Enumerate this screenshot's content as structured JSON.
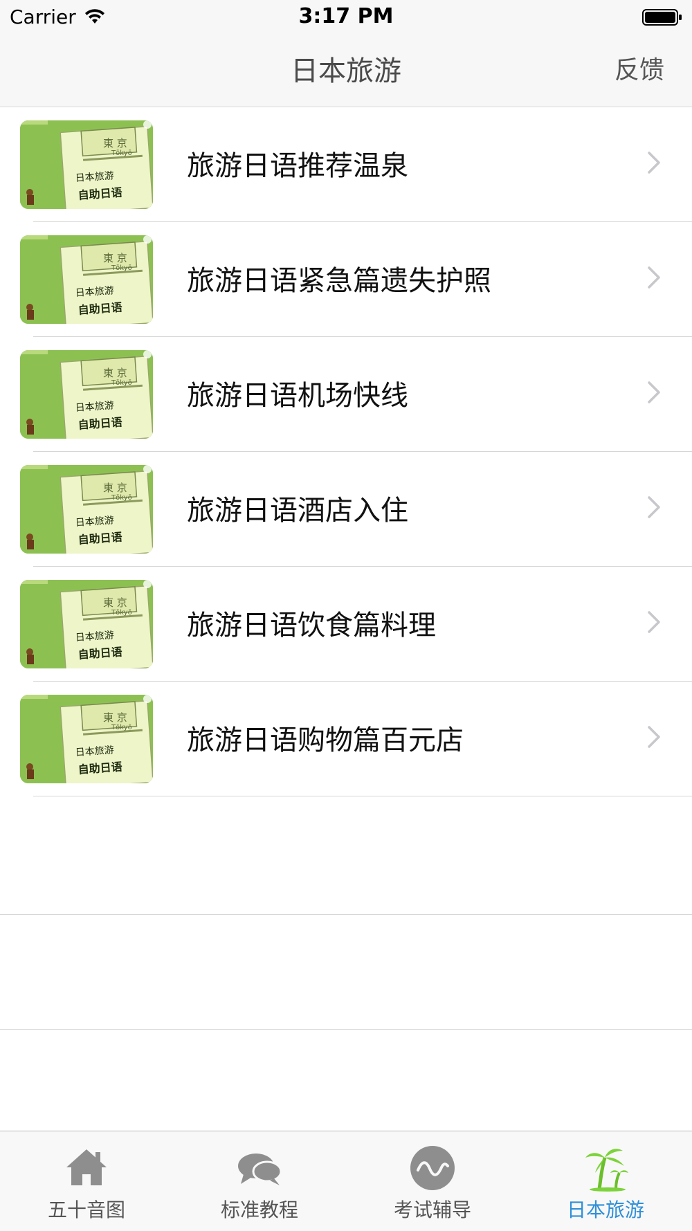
{
  "status_bar": {
    "carrier": "Carrier",
    "time": "3:17 PM"
  },
  "nav": {
    "title": "日本旅游",
    "feedback_label": "反馈"
  },
  "thumbnail": {
    "city_kanji": "東 京",
    "city_romaji": "Tōkyō",
    "line1": "日本旅游",
    "line2": "自助日语"
  },
  "list": {
    "items": [
      {
        "label": "旅游日语推荐温泉"
      },
      {
        "label": "旅游日语紧急篇遗失护照"
      },
      {
        "label": "旅游日语机场快线"
      },
      {
        "label": "旅游日语酒店入住"
      },
      {
        "label": "旅游日语饮食篇料理"
      },
      {
        "label": "旅游日语购物篇百元店"
      }
    ]
  },
  "tab_bar": {
    "tabs": [
      {
        "label": "五十音图",
        "icon": "home-icon",
        "active": false
      },
      {
        "label": "标准教程",
        "icon": "chat-bubbles-icon",
        "active": false
      },
      {
        "label": "考试辅导",
        "icon": "wave-circle-icon",
        "active": false
      },
      {
        "label": "日本旅游",
        "icon": "palm-tree-icon",
        "active": true
      }
    ]
  },
  "colors": {
    "accent": "#2f8fd8",
    "thumb_green": "#8cc152",
    "inactive_icon": "#8e8e8e"
  }
}
